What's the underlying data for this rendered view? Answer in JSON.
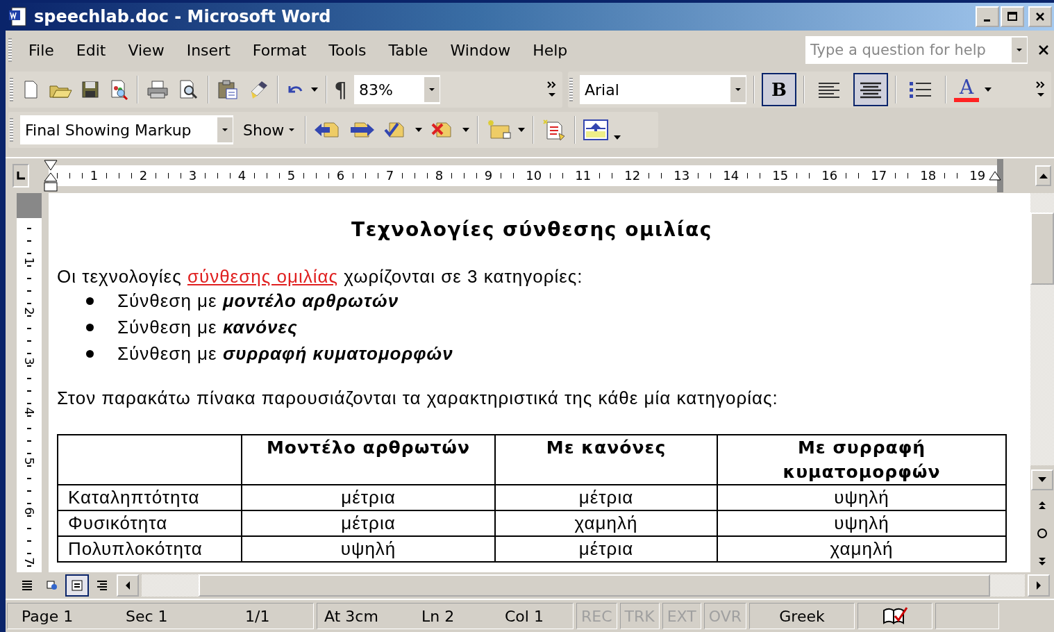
{
  "window": {
    "title": "speechlab.doc - Microsoft Word"
  },
  "menu": [
    {
      "label": "File"
    },
    {
      "label": "Edit"
    },
    {
      "label": "View"
    },
    {
      "label": "Insert"
    },
    {
      "label": "Format"
    },
    {
      "label": "Tools"
    },
    {
      "label": "Table"
    },
    {
      "label": "Window"
    },
    {
      "label": "Help"
    }
  ],
  "help_box": {
    "placeholder": "Type a question for help"
  },
  "standard_toolbar": {
    "show_marks": "¶",
    "zoom": "83%"
  },
  "formatting_toolbar": {
    "font": "Arial",
    "bold_label": "B",
    "bold_pressed": true,
    "align_left_pressed": false,
    "center_pressed": true,
    "bullets_pressed": false,
    "font_color_label": "A"
  },
  "reviewing_toolbar": {
    "display": "Final Showing Markup",
    "show": "Show"
  },
  "ruler": {
    "numbers": [
      "1",
      "2",
      "3",
      "4",
      "5",
      "6",
      "7",
      "8",
      "9",
      "10",
      "11",
      "12",
      "13",
      "14",
      "15",
      "16",
      "17",
      "18",
      "19"
    ]
  },
  "vertical_ruler": {
    "numbers": [
      "1",
      "2",
      "3",
      "4",
      "5",
      "6",
      "7"
    ]
  },
  "document": {
    "heading": "Τεχνολογίες σύνθεσης ομιλίας",
    "intro": [
      {
        "text": "Οι τεχνολογίες ",
        "inserted": false
      },
      {
        "text": "σύνθεσης ομιλίας",
        "inserted": true
      },
      {
        "text": " χωρίζονται σε 3 κατηγορίες:",
        "inserted": false
      }
    ],
    "bullets": [
      {
        "text": "Σύνθεση με ",
        "emphasis": "μοντέλο αρθρωτών"
      },
      {
        "text": "Σύνθεση με ",
        "emphasis": "κανόνες"
      },
      {
        "text": "Σύνθεση με ",
        "emphasis": "συρραφή κυματομορφών"
      }
    ],
    "table_intro": "Στον παρακάτω πίνακα παρουσιάζονται τα χαρακτηριστικά της κάθε μία κατηγορίας:",
    "table": {
      "columns": [
        "",
        "Μοντέλο αρθρωτών",
        "Με κανόνες",
        "Με συρραφή κυματομορφών"
      ],
      "rows": [
        [
          "Καταληπτότητα",
          "μέτρια",
          "μέτρια",
          "υψηλή"
        ],
        [
          "Φυσικότητα",
          "μέτρια",
          "χαμηλή",
          "υψηλή"
        ],
        [
          "Πολυπλοκότητα",
          "υψηλή",
          "μέτρια",
          "χαμηλή"
        ]
      ]
    }
  },
  "view_buttons": [
    {
      "selected": false
    },
    {
      "selected": false
    },
    {
      "selected": true
    },
    {
      "selected": false
    }
  ],
  "status_bar": {
    "groups": [
      [
        "Page 1",
        "Sec 1",
        "1/1"
      ],
      [
        "At 3cm",
        "Ln 2",
        "Col 1"
      ]
    ],
    "indicators": [
      {
        "label": "REC",
        "active": false
      },
      {
        "label": "TRK",
        "active": false
      },
      {
        "label": "EXT",
        "active": false
      },
      {
        "label": "OVR",
        "active": false
      }
    ],
    "language": "Greek"
  }
}
